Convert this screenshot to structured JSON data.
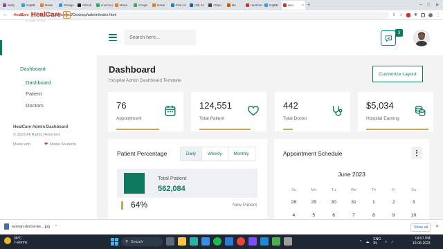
{
  "browser": {
    "tabs": [
      {
        "label": "Welly",
        "color": "#8e44ad"
      },
      {
        "label": "ImgBB",
        "color": "#2d9cdb"
      },
      {
        "label": "Masai",
        "color": "#e67e22"
      },
      {
        "label": "Storage",
        "color": "#3498db"
      },
      {
        "label": "GitHub",
        "color": "#222222"
      },
      {
        "label": "enormous",
        "color": "#27ae60"
      },
      {
        "label": "Masai",
        "color": "#e67e22"
      },
      {
        "label": "Google",
        "color": "#34a853"
      },
      {
        "label": "Masai",
        "color": "#e67e22"
      },
      {
        "label": "Post Ad",
        "color": "#2980b9"
      },
      {
        "label": "(20) Fo",
        "color": "#0a66c2"
      },
      {
        "label": "<Impo",
        "color": "#444444"
      },
      {
        "label": "Me",
        "color": "#d35400"
      },
      {
        "label": "HealCare",
        "color": "#c0392b"
      },
      {
        "label": "ImgBB",
        "color": "#2d9cdb"
      },
      {
        "label": "Hea",
        "color": "#c0392b",
        "active": true
      }
    ],
    "address": {
      "scheme": "File",
      "path": "C:/Users/vipul/Desktop/admin/index.html"
    }
  },
  "sidebar": {
    "logo": {
      "small": "HealCare",
      "main": "HealCare",
      "tagline": "Your Health, Our Care"
    },
    "section": "Dashboard",
    "items": [
      {
        "label": "Dashboard",
        "active": true
      },
      {
        "label": "Patient",
        "active": false
      },
      {
        "label": "Doctors",
        "active": false
      }
    ],
    "footer": {
      "title": "HealCare Admin Dashboard",
      "copyright": "© 2023 All Rights Reserved",
      "made_with": "Made with",
      "by": "Masai Students"
    }
  },
  "header": {
    "search_placeholder": "Search here...",
    "notification_count": "3"
  },
  "page": {
    "title": "Dashboard",
    "subtitle": "Hospital Admin Dashboard Template",
    "customize_label": "Customize Layout"
  },
  "stats": [
    {
      "value": "76",
      "label": "Appointment",
      "icon": "calendar-icon"
    },
    {
      "value": "124,551",
      "label": "Total Patient",
      "icon": "heart-icon"
    },
    {
      "value": "442",
      "label": "Total Doctor",
      "icon": "stethoscope-icon"
    },
    {
      "value": "$5,034",
      "label": "Hospital Earning",
      "icon": "coins-icon"
    }
  ],
  "patient_percentage": {
    "title": "Patient Percentage",
    "tabs": [
      {
        "label": "Daily",
        "active": true
      },
      {
        "label": "Weekly",
        "active": false
      },
      {
        "label": "Monthly",
        "active": false
      }
    ],
    "total_label": "Total Patient",
    "total_value": "562,084",
    "percent": "64%",
    "percent_label": "New Patient",
    "accent": "#0d7a5f",
    "gold": "#c8a15a"
  },
  "appointment": {
    "title": "Appointment Schedule",
    "month": "June 2023",
    "weekdays": [
      "Su",
      "Mo",
      "Tu",
      "We",
      "Th",
      "Fr",
      "Sa"
    ],
    "weeks": [
      [
        "28",
        "29",
        "30",
        "31",
        "1",
        "2",
        "3"
      ],
      [
        "4",
        "5",
        "6",
        "7",
        "8",
        "9",
        "10"
      ]
    ]
  },
  "download": {
    "file": "woman-doctor-we....jpg",
    "show_all": "Show all"
  },
  "taskbar": {
    "temp": "36°C",
    "weather": "T-storms",
    "search": "Search",
    "lang_top": "ENG",
    "lang_bottom": "IN",
    "time": "04:57 PM",
    "date": "19-06-2023"
  }
}
